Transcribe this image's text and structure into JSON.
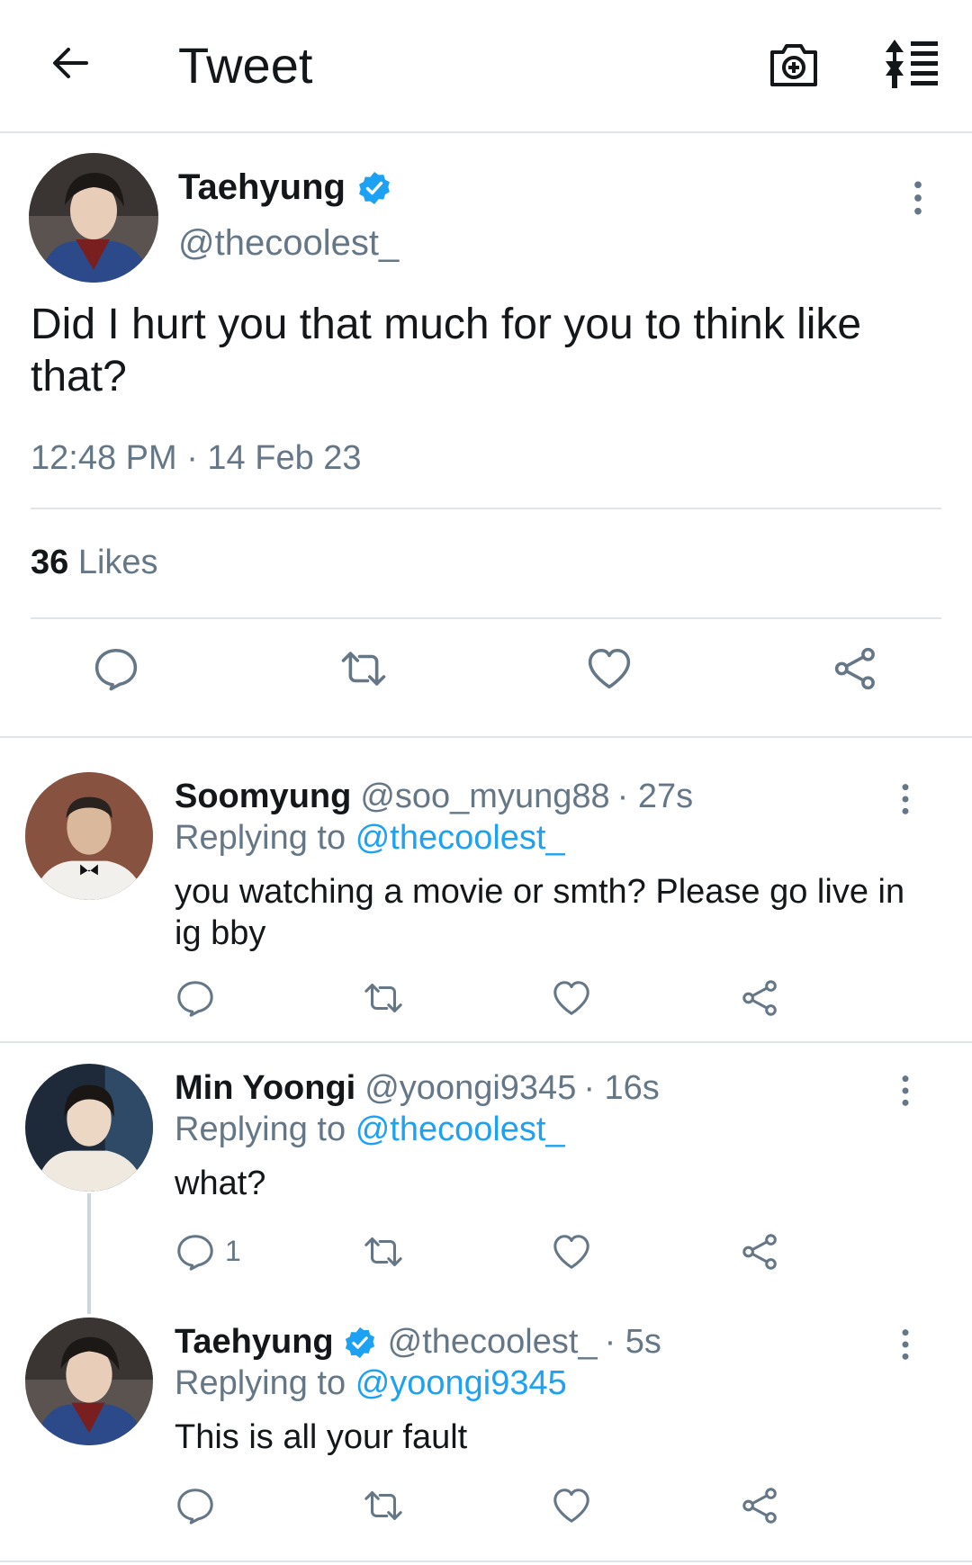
{
  "header": {
    "title": "Tweet",
    "icons": [
      "back-arrow-icon",
      "camera-add-icon",
      "sort-icon"
    ]
  },
  "main_tweet": {
    "name": "Taehyung",
    "verified": true,
    "handle": "@thecoolest_",
    "text": "Did I hurt you that much for you to think like that?",
    "timestamp": "12:48 PM · 14 Feb 23",
    "likes_count": "36",
    "likes_label": "Likes"
  },
  "replies": [
    {
      "name": "Soomyung",
      "verified": false,
      "handle": "@soo_myung88",
      "time": "· 27s",
      "replying_label": "Replying to",
      "replying_to": "@thecoolest_",
      "text": "you watching a movie or smth? Please go live in ig bby",
      "reply_count": ""
    },
    {
      "name": "Min Yoongi",
      "verified": false,
      "handle": "@yoongi9345",
      "time": "· 16s",
      "replying_label": "Replying to",
      "replying_to": "@thecoolest_",
      "text": "what?",
      "reply_count": "1"
    },
    {
      "name": "Taehyung",
      "verified": true,
      "handle": "@thecoolest_",
      "time": "· 5s",
      "replying_label": "Replying to",
      "replying_to": "@yoongi9345",
      "text": "This is all your fault",
      "reply_count": ""
    }
  ],
  "colors": {
    "accent": "#1da1f2",
    "text_primary": "#14171a",
    "text_secondary": "#657786",
    "divider": "#e1e4e6"
  }
}
